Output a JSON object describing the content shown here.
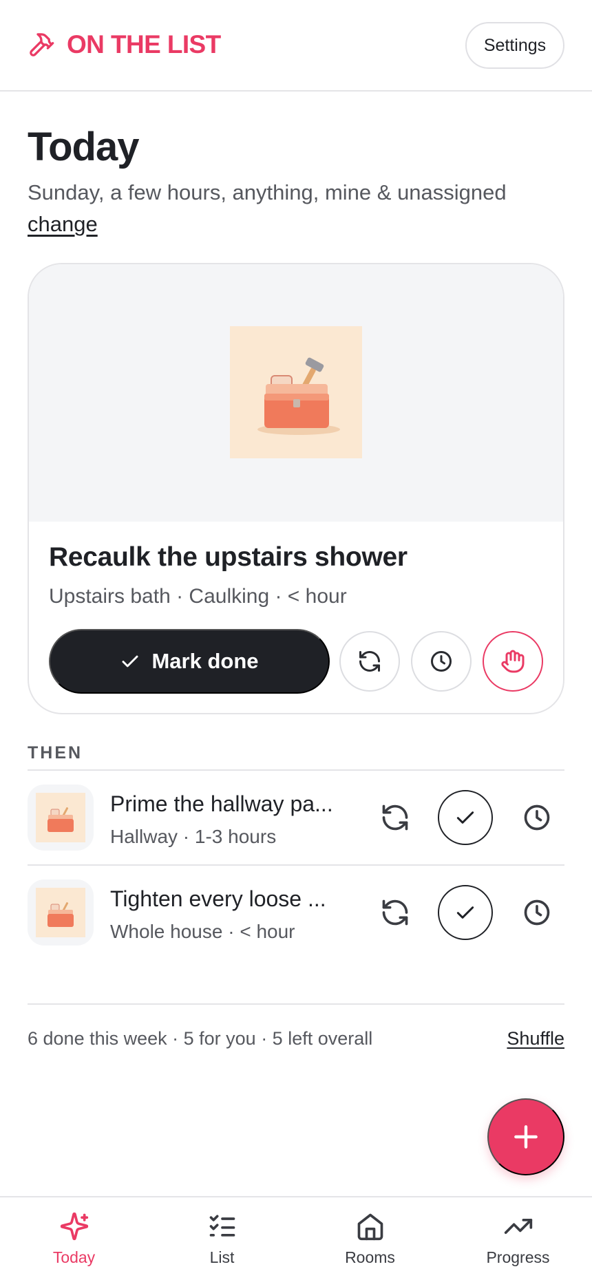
{
  "colors": {
    "accent": "#ea3a64",
    "dark": "#1f2126",
    "muted": "#56585e",
    "thumb_bg": "#fbe8d2"
  },
  "header": {
    "brand": "ON THE LIST",
    "brand_icon": "hammer-icon",
    "settings_label": "Settings"
  },
  "today": {
    "title": "Today",
    "subtitle": "Sunday, a few hours, anything, mine & unassigned",
    "change_label": "change"
  },
  "hero": {
    "image_icon": "toolbox-icon",
    "title": "Recaulk the upstairs shower",
    "meta": "Upstairs bath · Caulking · < hour",
    "mark_done_label": "Mark done",
    "actions": [
      "refresh-icon",
      "clock-icon",
      "hand-icon"
    ]
  },
  "then": {
    "label": "THEN",
    "items": [
      {
        "title": "Prime the hallway pa...",
        "meta": "Hallway · 1-3 hours"
      },
      {
        "title": "Tighten every loose ...",
        "meta": "Whole house · < hour"
      }
    ]
  },
  "footer": {
    "stats": "6 done this week · 5 for you · 5 left overall",
    "shuffle_label": "Shuffle"
  },
  "nav": {
    "items": [
      {
        "label": "Today",
        "icon": "sparkles-icon",
        "active": true
      },
      {
        "label": "List",
        "icon": "checklist-icon",
        "active": false
      },
      {
        "label": "Rooms",
        "icon": "home-icon",
        "active": false
      },
      {
        "label": "Progress",
        "icon": "trending-up-icon",
        "active": false
      }
    ]
  }
}
